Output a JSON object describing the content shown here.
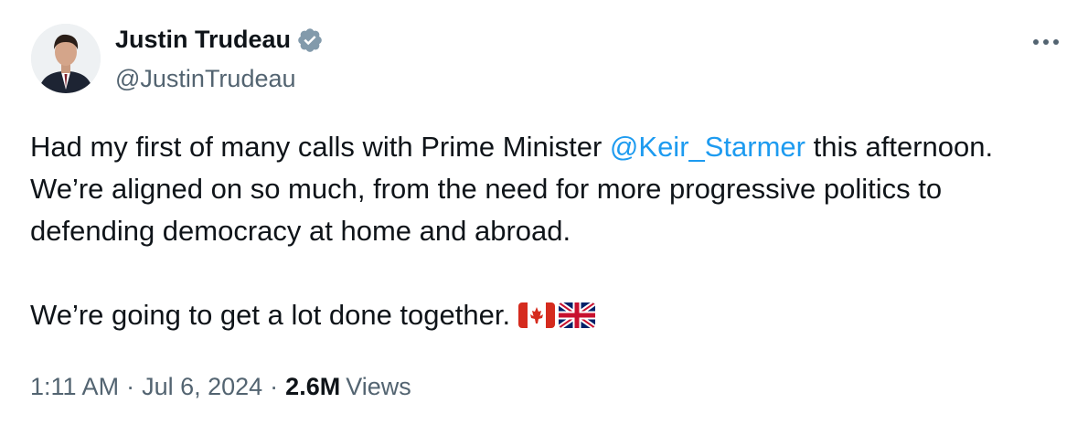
{
  "author": {
    "name": "Justin Trudeau",
    "handle": "@JustinTrudeau",
    "verified_icon": "verified-badge-icon"
  },
  "tweet": {
    "text_part1": "Had my first of many calls with Prime Minister ",
    "mention": "@Keir_Starmer",
    "text_part2": " this afternoon. We’re aligned on so much, from the need for more progressive politics to defending democracy at home and abroad.\n\nWe’re going to get a lot done together. ",
    "emojis": [
      "canada-flag-icon",
      "uk-flag-icon"
    ]
  },
  "meta": {
    "time": "1:11 AM",
    "date": "Jul 6, 2024",
    "separator": "·",
    "views_count": "2.6M",
    "views_label": "Views"
  },
  "colors": {
    "text": "#0f1419",
    "secondary": "#536471",
    "link": "#1d9bf0",
    "verified_badge": "#829aab"
  }
}
